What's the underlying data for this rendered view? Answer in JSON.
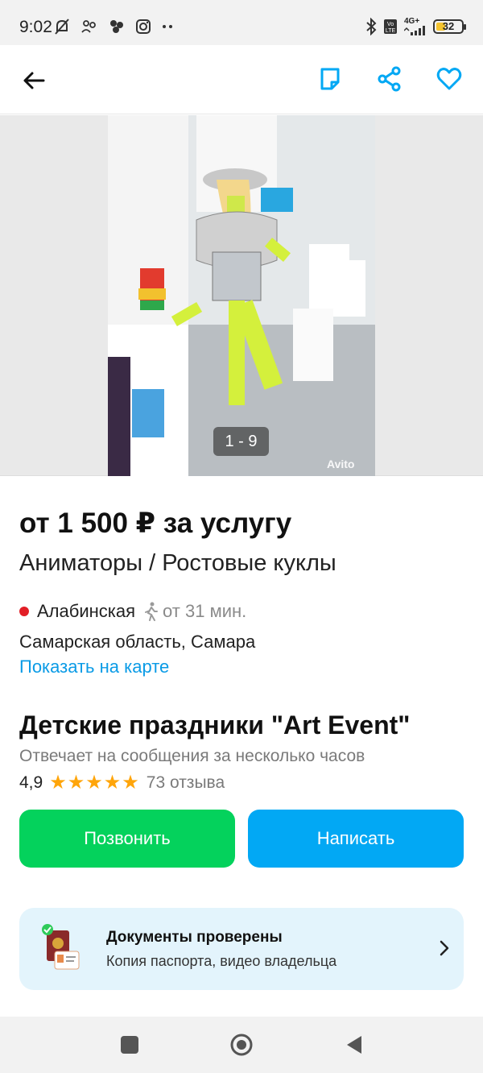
{
  "status_bar": {
    "time": "9:02",
    "network": "4G+",
    "battery": "32"
  },
  "gallery": {
    "counter": "1 - 9",
    "watermark": "Avito"
  },
  "listing": {
    "price": "от 1 500 ₽ за услугу",
    "category": "Аниматоры / Ростовые куклы",
    "metro_station": "Алабинская",
    "walk_time": "от 31 мин.",
    "address": "Самарская область, Самара",
    "map_link": "Показать на карте"
  },
  "seller": {
    "name": "Детские праздники \"Art Event\"",
    "reply_info": "Отвечает на сообщения за несколько часов",
    "rating": "4,9",
    "stars": 5,
    "reviews": "73 отзыва"
  },
  "actions": {
    "call": "Позвонить",
    "write": "Написать"
  },
  "verification": {
    "title": "Документы проверены",
    "subtitle": "Копия паспорта, видео владельца"
  },
  "colors": {
    "call_button": "#04d25c",
    "write_button": "#02a8f4",
    "link": "#0a9be6",
    "metro_dot": "#e21e26",
    "stars": "#ffa50a"
  }
}
